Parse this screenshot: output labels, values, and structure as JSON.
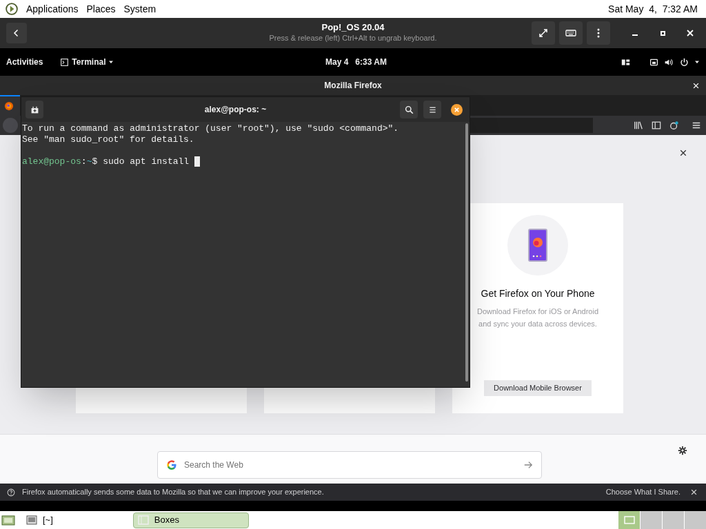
{
  "top_panel": {
    "menus": [
      "Applications",
      "Places",
      "System"
    ],
    "clock": "Sat May  4,  7:32 AM"
  },
  "boxes_header": {
    "title": "Pop!_OS 20.04",
    "subtitle": "Press & release (left) Ctrl+Alt to ungrab keyboard."
  },
  "gnome_bar": {
    "activities": "Activities",
    "app_menu": "Terminal",
    "date": "May 4",
    "time": "6:33 AM"
  },
  "firefox": {
    "title": "Mozilla Firefox",
    "card": {
      "title": "Get Firefox on Your Phone",
      "body": "Download Firefox for iOS or Android and sync your data across devices.",
      "button": "Download Mobile Browser"
    },
    "search_placeholder": "Search the Web",
    "notification": {
      "text": "Firefox automatically sends some data to Mozilla so that we can improve your experience.",
      "action": "Choose What I Share."
    }
  },
  "terminal": {
    "title": "alex@pop-os: ~",
    "lines": [
      "To run a command as administrator (user \"root\"), use \"sudo <command>\".",
      "See \"man sudo_root\" for details."
    ],
    "prompt": {
      "user": "alex@pop-os",
      "separator": ":",
      "path": "~",
      "symbol": "$",
      "command": "sudo apt install"
    }
  },
  "bottom_panel": {
    "items": [
      {
        "label": "[~]",
        "selected": false
      },
      {
        "label": "Boxes",
        "selected": true
      }
    ],
    "workspaces": [
      {
        "selected": true
      },
      {
        "selected": false
      },
      {
        "selected": false
      },
      {
        "selected": false
      }
    ]
  }
}
